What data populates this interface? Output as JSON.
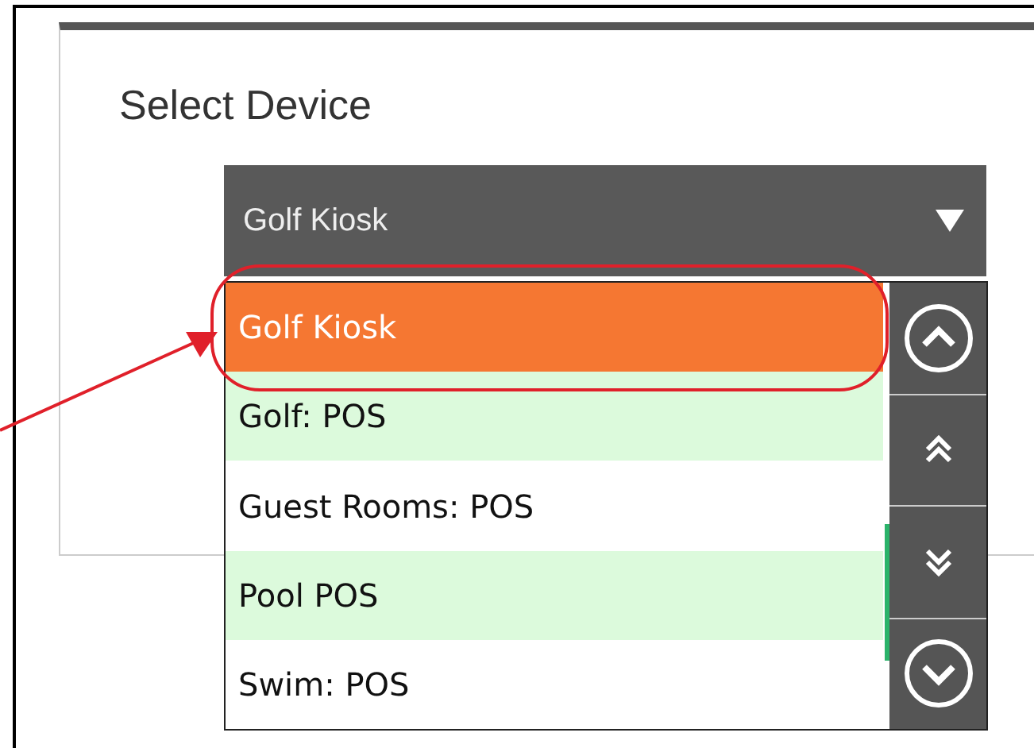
{
  "title": "Select Device",
  "dropdown": {
    "value": "Golf Kiosk"
  },
  "options": [
    {
      "label": "Golf Kiosk",
      "selected": true
    },
    {
      "label": "Golf: POS",
      "selected": false
    },
    {
      "label": "Guest Rooms: POS",
      "selected": false
    },
    {
      "label": "Pool POS",
      "selected": false
    },
    {
      "label": "Swim: POS",
      "selected": false
    }
  ],
  "scroll_buttons": [
    {
      "kind": "up"
    },
    {
      "kind": "page-up"
    },
    {
      "kind": "page-down"
    },
    {
      "kind": "down"
    }
  ]
}
